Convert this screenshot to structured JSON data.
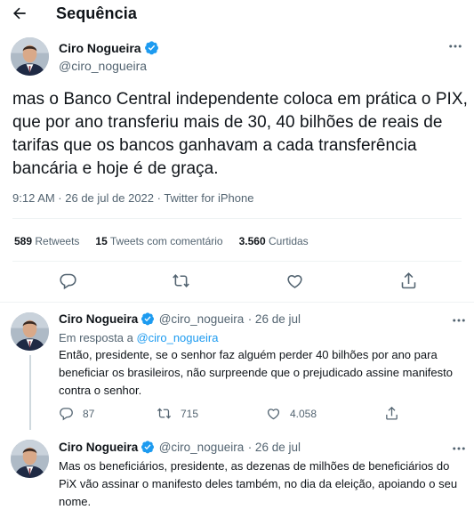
{
  "header": {
    "title": "Sequência"
  },
  "main_tweet": {
    "author_name": "Ciro Nogueira",
    "handle": "@ciro_nogueira",
    "text": "mas o Banco Central independente coloca em prática o PIX, que por ano transferiu mais de 30, 40 bilhões de reais de tarifas que os bancos ganhavam a cada transferência bancária e hoje é de graça.",
    "meta": "9:12 AM · 26 de jul de 2022 · Twitter for iPhone",
    "stats": {
      "retweets_count": "589",
      "retweets_label": "Retweets",
      "quotes_count": "15",
      "quotes_label": "Tweets com comentário",
      "likes_count": "3.560",
      "likes_label": "Curtidas"
    }
  },
  "replies": [
    {
      "author_name": "Ciro Nogueira",
      "handle": "@ciro_nogueira",
      "date": "· 26 de jul",
      "reply_to_prefix": "Em resposta a",
      "reply_to_handle": "@ciro_nogueira",
      "text": "Então, presidente, se o senhor faz alguém perder 40 bilhões por ano para beneficiar os brasileiros, não surpreende que o prejudicado assine manifesto contra o senhor.",
      "replies_count": "87",
      "retweets_count": "715",
      "likes_count": "4.058"
    },
    {
      "author_name": "Ciro Nogueira",
      "handle": "@ciro_nogueira",
      "date": "· 26 de jul",
      "text": "Mas os beneficiários, presidente, as dezenas de milhões de beneficiários do PiX vão assinar o manifesto deles também, no dia da eleição, apoiando o seu nome."
    }
  ],
  "icons": {
    "back": "arrow-left-icon",
    "more": "more-horizontal-icon",
    "verified": "verified-badge-icon",
    "reply": "comment-icon",
    "retweet": "retweet-icon",
    "like": "heart-icon",
    "share": "share-icon"
  },
  "colors": {
    "accent": "#1d9bf0",
    "secondary_text": "#536471",
    "divider": "#eff3f4"
  }
}
